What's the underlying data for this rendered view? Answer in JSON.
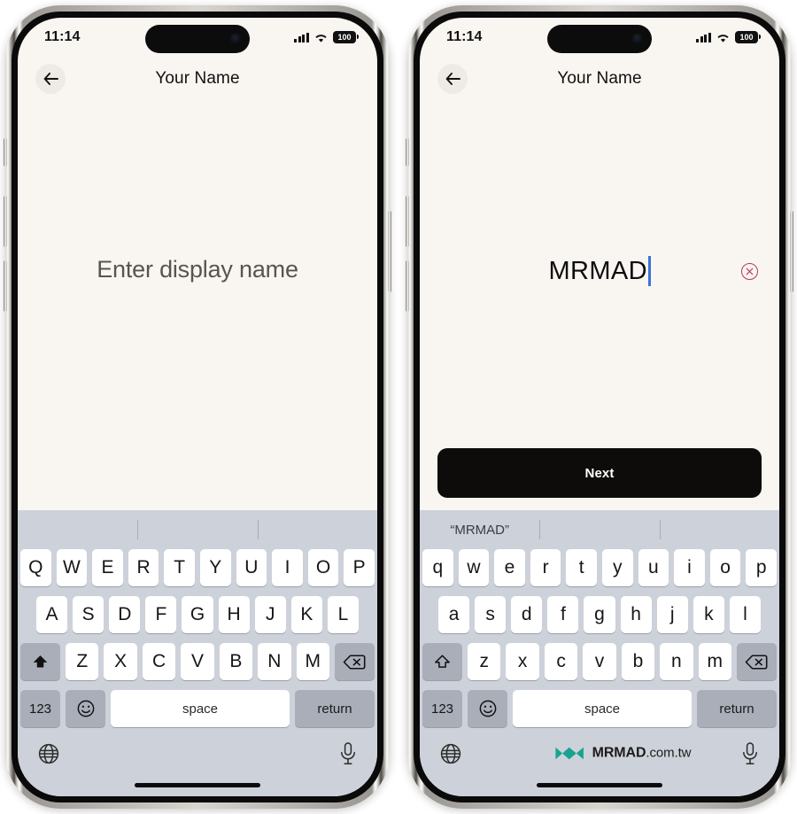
{
  "status_bar": {
    "time": "11:14",
    "battery_level": "100",
    "signal_icon": "cellular-bars-icon",
    "wifi_icon": "wifi-icon",
    "battery_icon": "battery-icon"
  },
  "nav": {
    "title": "Your Name",
    "back_icon": "back-arrow-icon"
  },
  "colors": {
    "app_background": "#f9f5f1",
    "keyboard_background": "#cdd1d9",
    "key_face": "#ffffff",
    "key_modifier": "#a9aeb9",
    "next_button": "#0d0c0a",
    "caret": "#3b72d8",
    "clear_button_border": "#b8355c",
    "watermark_logo": "#18a391"
  },
  "left_phone": {
    "field": {
      "placeholder": "Enter display name",
      "value": "",
      "state": "empty"
    },
    "keyboard": {
      "case": "uppercase",
      "shift_state": "filled",
      "predictions": [
        "",
        "",
        ""
      ],
      "row1": [
        "Q",
        "W",
        "E",
        "R",
        "T",
        "Y",
        "U",
        "I",
        "O",
        "P"
      ],
      "row2": [
        "A",
        "S",
        "D",
        "F",
        "G",
        "H",
        "J",
        "K",
        "L"
      ],
      "row3": [
        "Z",
        "X",
        "C",
        "V",
        "B",
        "N",
        "M"
      ],
      "shift_icon": "shift-up-filled-icon",
      "backspace_icon": "backspace-delete-icon",
      "numbers_key": "123",
      "emoji_key": "emoji-smiley-icon",
      "space_key": "space",
      "return_key": "return",
      "globe_icon": "globe-language-icon",
      "mic_icon": "microphone-dictation-icon"
    }
  },
  "right_phone": {
    "field": {
      "placeholder": "Enter display name",
      "value": "MRMAD",
      "state": "filled",
      "clear_icon": "clear-circle-x-icon",
      "caret_visible": true
    },
    "next_button_label": "Next",
    "keyboard": {
      "case": "lowercase",
      "shift_state": "outline",
      "predictions": [
        "“MRMAD”",
        "",
        ""
      ],
      "row1": [
        "q",
        "w",
        "e",
        "r",
        "t",
        "y",
        "u",
        "i",
        "o",
        "p"
      ],
      "row2": [
        "a",
        "s",
        "d",
        "f",
        "g",
        "h",
        "j",
        "k",
        "l"
      ],
      "row3": [
        "z",
        "x",
        "c",
        "v",
        "b",
        "n",
        "m"
      ],
      "shift_icon": "shift-up-outline-icon",
      "backspace_icon": "backspace-delete-icon",
      "numbers_key": "123",
      "emoji_key": "emoji-smiley-icon",
      "space_key": "space",
      "return_key": "return",
      "globe_icon": "globe-language-icon",
      "mic_icon": "microphone-dictation-icon"
    },
    "watermark": {
      "brand": "MRMAD",
      "domain": ".com.tw",
      "logo_icon": "mrmad-bowtie-logo-icon"
    }
  }
}
